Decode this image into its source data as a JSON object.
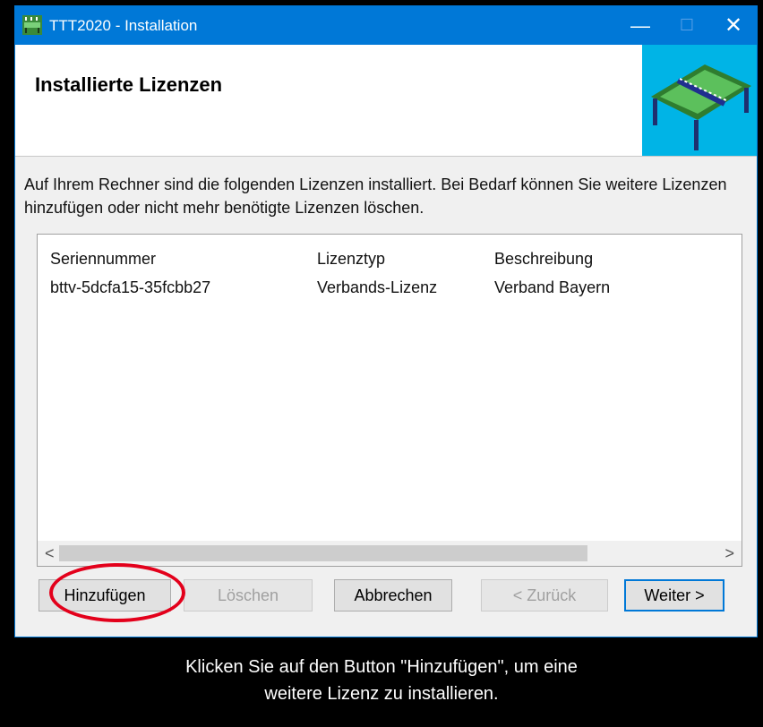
{
  "window": {
    "title": "TTT2020 - Installation",
    "controls": {
      "minimize": "—",
      "maximize": "☐",
      "close": "✕"
    },
    "accent_color": "#0078d7"
  },
  "header": {
    "title": "Installierte Lizenzen",
    "image_icon": "table-tennis-table-icon"
  },
  "intro_text": "Auf Ihrem Rechner sind die folgenden Lizenzen installiert. Bei Bedarf können Sie weitere Lizenzen hinzufügen oder nicht mehr benötigte Lizenzen löschen.",
  "license_list": {
    "columns": [
      "Seriennummer",
      "Lizenztyp",
      "Beschreibung"
    ],
    "rows": [
      [
        "bttv-5dcfa15-35fcbb27",
        "Verbands-Lizenz",
        "Verband Bayern"
      ]
    ],
    "scroll_left": "<",
    "scroll_right": ">"
  },
  "buttons": {
    "add": "Hinzufügen",
    "delete": "Löschen",
    "cancel": "Abbrechen",
    "back": "< Zurück",
    "next": "Weiter >"
  },
  "annotation": {
    "highlight_color": "#e3001b",
    "caption_line1": "Klicken Sie auf den Button \"Hinzufügen\", um eine",
    "caption_line2": "weitere Lizenz zu installieren."
  }
}
